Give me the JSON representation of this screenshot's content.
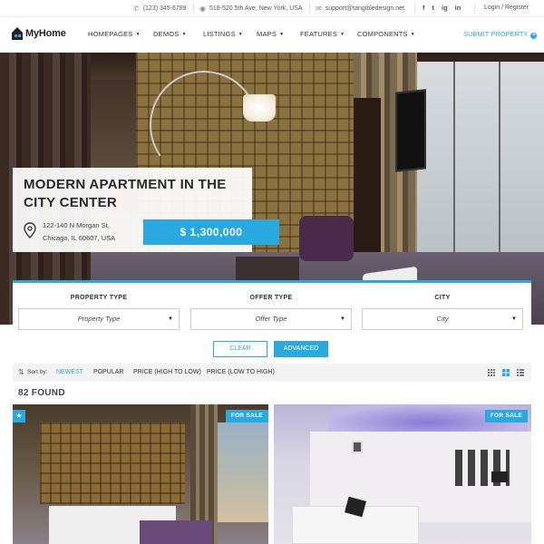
{
  "topbar": {
    "phone": "(123) 345-6789",
    "address": "518-520 5th Ave, New York, USA",
    "email": "support@tangibledesign.net",
    "social": [
      "f",
      "t",
      "ig",
      "in"
    ],
    "login": "Login / Register"
  },
  "nav": {
    "logo": "MyHome",
    "items": [
      "HOMEPAGES",
      "DEMOS",
      "LISTINGS",
      "MAPS",
      "FEATURES",
      "COMPONENTS"
    ],
    "submit": "SUBMIT PROPERTY"
  },
  "hero": {
    "title": "MODERN APARTMENT IN THE CITY CENTER",
    "address_line1": "122-140 N Morgan St,",
    "address_line2": "Chicago, IL 60607, USA",
    "price": "$ 1,300,000"
  },
  "search": {
    "property_type_label": "PROPERTY TYPE",
    "property_type_value": "Property Type",
    "offer_type_label": "OFFER TYPE",
    "offer_type_value": "Offer Type",
    "city_label": "CITY",
    "city_value": "City",
    "clear": "CLEAR",
    "advanced": "ADVANCED"
  },
  "sort": {
    "label": "Sort by:",
    "options": [
      "NEWEST",
      "POPULAR",
      "PRICE (HIGH TO LOW)",
      "PRICE (LOW TO HIGH)"
    ]
  },
  "results": {
    "found": "82 FOUND",
    "cards": [
      {
        "badge": "FOR SALE"
      },
      {
        "badge": "FOR SALE"
      }
    ]
  },
  "colors": {
    "accent": "#29a9e0"
  }
}
